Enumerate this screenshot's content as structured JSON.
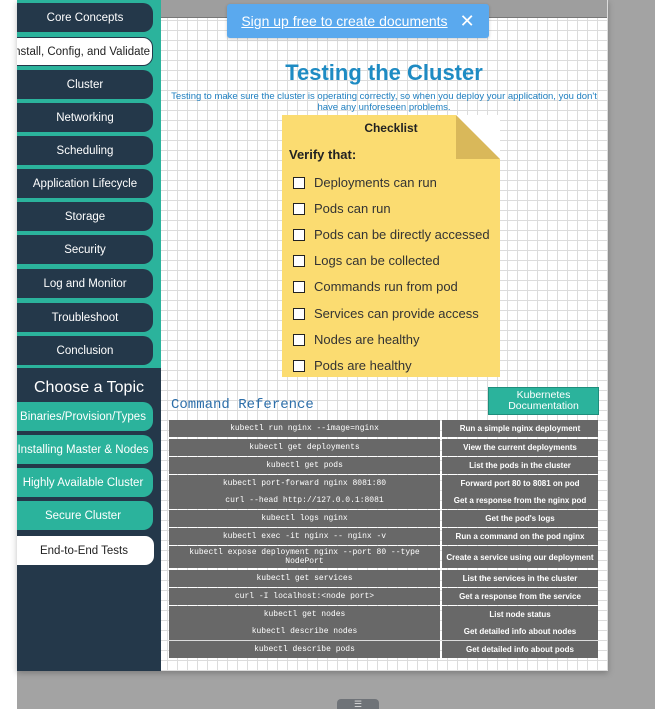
{
  "sidebar": {
    "items": [
      {
        "label": "Core Concepts"
      },
      {
        "label": "Install, Config, and Validate"
      },
      {
        "label": "Cluster"
      },
      {
        "label": "Networking"
      },
      {
        "label": "Scheduling"
      },
      {
        "label": "Application Lifecycle"
      },
      {
        "label": "Storage"
      },
      {
        "label": "Security"
      },
      {
        "label": "Log and Monitor"
      },
      {
        "label": "Troubleshoot"
      },
      {
        "label": "Conclusion"
      }
    ],
    "topics_title": "Choose a Topic",
    "topics": [
      {
        "label": "Binaries/Provision/Types"
      },
      {
        "label": "Installing Master & Nodes"
      },
      {
        "label": "Highly Available Cluster"
      },
      {
        "label": "Secure Cluster"
      },
      {
        "label": "End-to-End Tests"
      }
    ]
  },
  "banner": {
    "link_text": "Sign up free to create documents",
    "close": "✕"
  },
  "main": {
    "title": "Testing the Cluster",
    "subtitle": "Testing to make sure the cluster is operating correctly, so when you deploy your application, you don't have any unforeseen problems.",
    "checklist": {
      "title": "Checklist",
      "verify": "Verify that:",
      "items": [
        "Deployments can run",
        "Pods can run",
        "Pods can be directly accessed",
        "Logs can be collected",
        "Commands run from pod",
        "Services can provide access",
        "Nodes are healthy",
        "Pods are healthy"
      ]
    },
    "command_reference": {
      "title": "Command Reference",
      "docs_button": "Kubernetes Documentation",
      "rows": [
        {
          "cmd": "kubectl run nginx --image=nginx",
          "desc": "Run a simple nginx deployment"
        },
        {
          "cmd": "kubectl get deployments",
          "desc": "View the current deployments"
        },
        {
          "cmd": "kubectl get pods",
          "desc": "List the pods in the cluster"
        },
        {
          "cmd": "kubectl port-forward nginx 8081:80",
          "desc": "Forward port 80 to 8081 on pod"
        },
        {
          "cmd": "curl --head http://127.0.0.1:8081",
          "desc": "Get a response from the nginx pod"
        },
        {
          "cmd": "kubectl logs nginx",
          "desc": "Get the pod's logs"
        },
        {
          "cmd": "kubectl exec -it nginx -- nginx -v",
          "desc": "Run a command on the pod nginx"
        },
        {
          "cmd": "kubectl expose deployment nginx --port 80 --type NodePort",
          "desc": "Create a service using our deployment"
        },
        {
          "cmd": "kubectl get services",
          "desc": "List the services in the cluster"
        },
        {
          "cmd": "curl -I localhost:<node port>",
          "desc": "Get a response from the service"
        },
        {
          "cmd": "kubectl get nodes",
          "desc": "List node status"
        },
        {
          "cmd": "kubectl describe nodes",
          "desc": "Get detailed info about nodes"
        },
        {
          "cmd": "kubectl describe pods",
          "desc": "Get detailed info about pods"
        }
      ]
    }
  },
  "colors": {
    "teal": "#2bb39c",
    "navy": "#24384a",
    "sticky": "#fbdc71",
    "title_blue": "#1e8bc3",
    "banner": "#5aa9ee"
  }
}
